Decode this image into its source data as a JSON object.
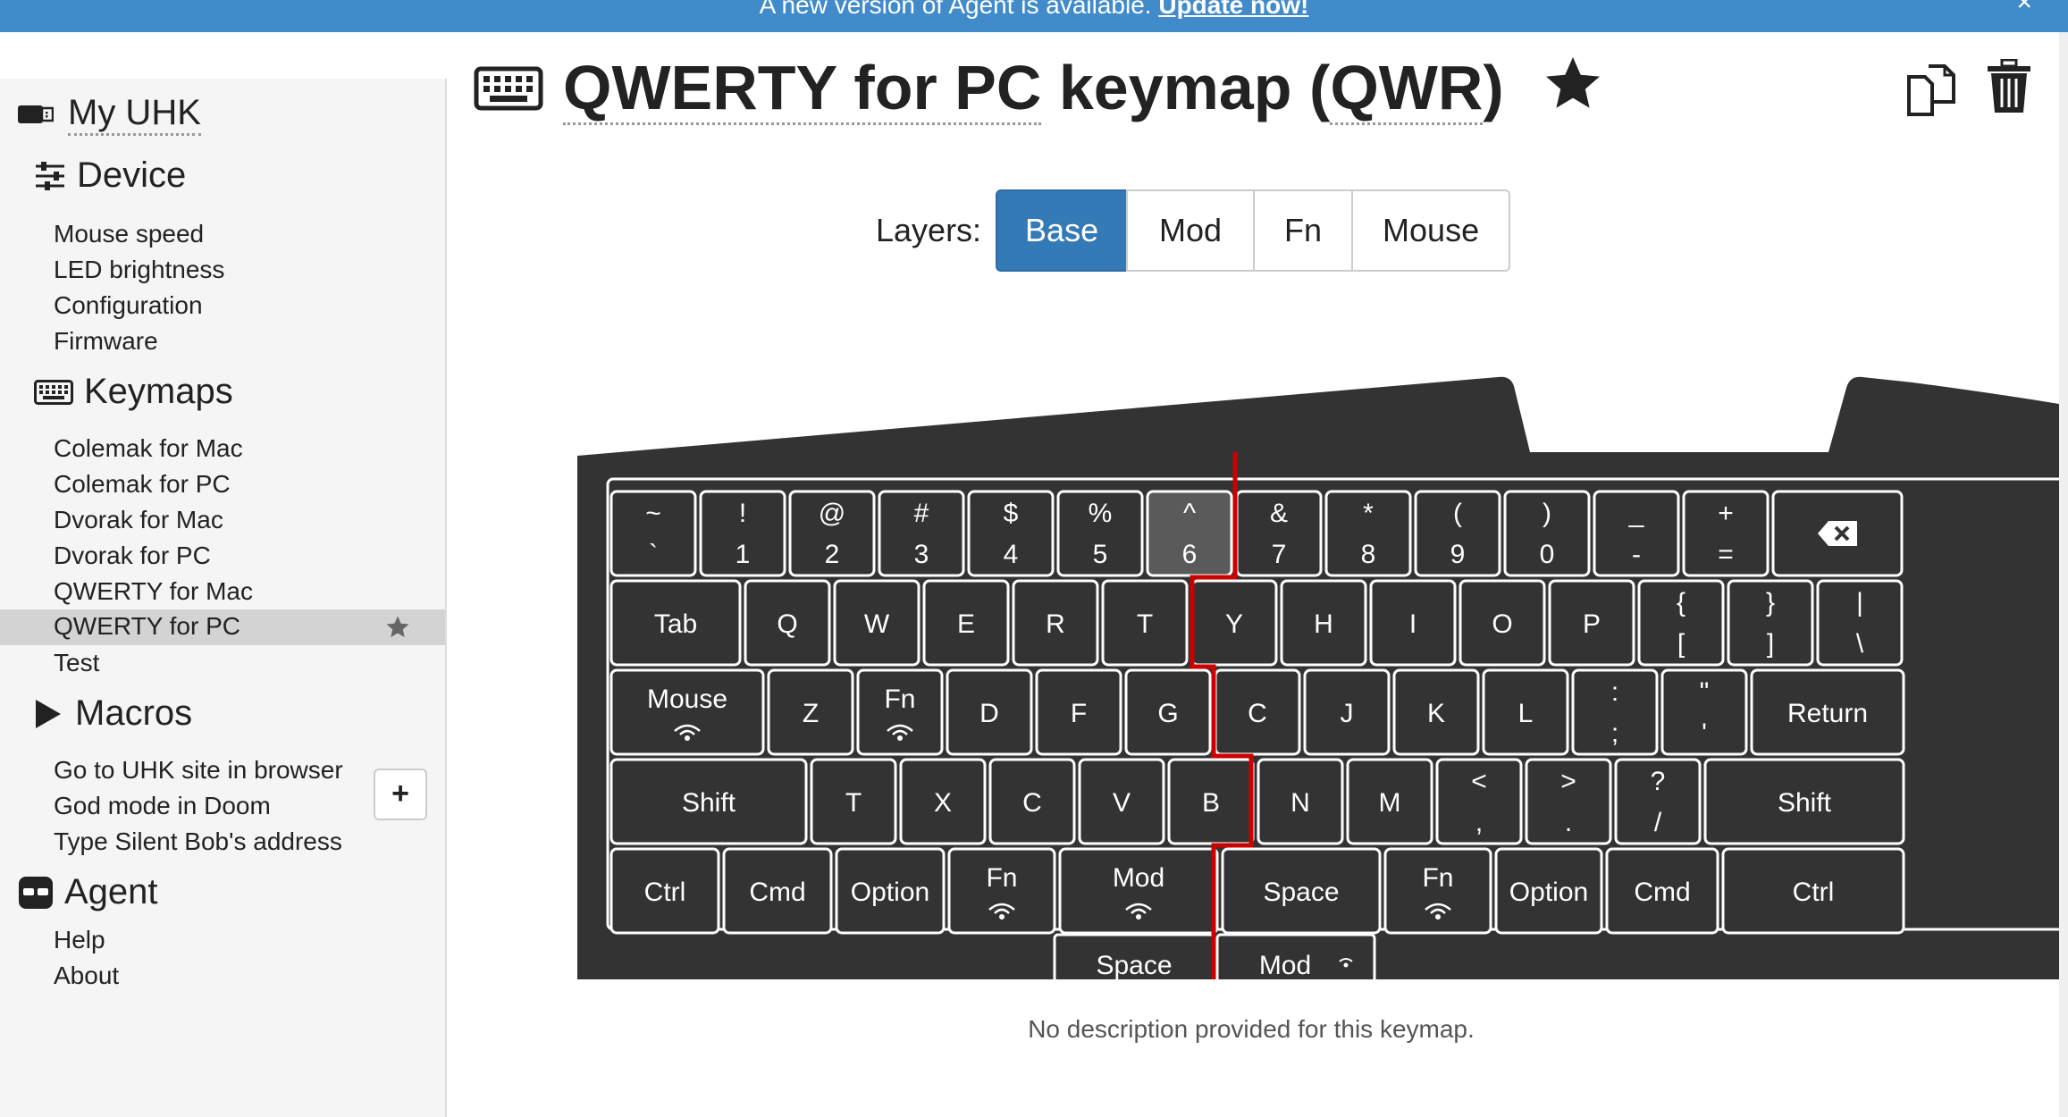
{
  "banner": {
    "text": "A new version of Agent is available.",
    "link": "Update now!",
    "close": "×"
  },
  "sidebar": {
    "my_uhk": "My UHK",
    "device": {
      "title": "Device",
      "items": [
        "Mouse speed",
        "LED brightness",
        "Configuration",
        "Firmware"
      ]
    },
    "keymaps": {
      "title": "Keymaps",
      "items": [
        "Colemak for Mac",
        "Colemak for PC",
        "Dvorak for Mac",
        "Dvorak for PC",
        "QWERTY for Mac",
        "QWERTY for PC",
        "Test"
      ],
      "active": "QWERTY for PC"
    },
    "macros": {
      "title": "Macros",
      "add": "+",
      "items": [
        "Go to UHK site in browser",
        "God mode in Doom",
        "Type Silent Bob's address"
      ]
    },
    "agent": {
      "title": "Agent",
      "items": [
        "Help",
        "About"
      ]
    }
  },
  "header": {
    "name": "QWERTY for PC",
    "suffix": "keymap",
    "abbr_open": "(",
    "abbr": "QWR",
    "abbr_close": ")"
  },
  "layers": {
    "label": "Layers:",
    "options": [
      "Base",
      "Mod",
      "Fn",
      "Mouse"
    ],
    "selected": "Base"
  },
  "keyboard": {
    "rows": [
      [
        {
          "t": "~",
          "b": "`"
        },
        {
          "t": "!",
          "b": "1"
        },
        {
          "t": "@",
          "b": "2"
        },
        {
          "t": "#",
          "b": "3"
        },
        {
          "t": "$",
          "b": "4"
        },
        {
          "t": "%",
          "b": "5"
        },
        {
          "t": "^",
          "b": "6",
          "hl": true
        },
        {
          "t": "&",
          "b": "7"
        },
        {
          "t": "*",
          "b": "8"
        },
        {
          "t": "(",
          "b": "9"
        },
        {
          "t": ")",
          "b": "0"
        },
        {
          "t": "_",
          "b": "-"
        },
        {
          "t": "+",
          "b": "="
        },
        {
          "icon": "backspace-icon"
        }
      ],
      [
        {
          "l": "Tab"
        },
        {
          "l": "Q"
        },
        {
          "l": "W"
        },
        {
          "l": "E"
        },
        {
          "l": "R"
        },
        {
          "l": "T"
        },
        {
          "l": "Y"
        },
        {
          "l": "H"
        },
        {
          "l": "I"
        },
        {
          "l": "O"
        },
        {
          "l": "P"
        },
        {
          "t": "{",
          "b": "["
        },
        {
          "t": "}",
          "b": "]"
        },
        {
          "t": "|",
          "b": "\\"
        }
      ],
      [
        {
          "l": "Mouse",
          "wave": true
        },
        {
          "l": "Z"
        },
        {
          "l": "Fn",
          "wave": true
        },
        {
          "l": "D"
        },
        {
          "l": "F"
        },
        {
          "l": "G"
        },
        {
          "l": "C"
        },
        {
          "l": "J"
        },
        {
          "l": "K"
        },
        {
          "l": "L"
        },
        {
          "t": ":",
          "b": ";"
        },
        {
          "t": "\"",
          "b": "'"
        },
        {
          "l": "Return"
        }
      ],
      [
        {
          "l": "Shift"
        },
        {
          "l": "T"
        },
        {
          "l": "X"
        },
        {
          "l": "C"
        },
        {
          "l": "V"
        },
        {
          "l": "B"
        },
        {
          "l": "N"
        },
        {
          "l": "M"
        },
        {
          "t": "<",
          "b": ","
        },
        {
          "t": ">",
          "b": "."
        },
        {
          "t": "?",
          "b": "/"
        },
        {
          "l": "Shift"
        }
      ],
      [
        {
          "l": "Ctrl"
        },
        {
          "l": "Cmd"
        },
        {
          "l": "Option"
        },
        {
          "l": "Fn",
          "wave": true
        },
        {
          "l": "Mod",
          "wave": true
        },
        {
          "l": "Space"
        },
        {
          "l": "Fn",
          "wave": true
        },
        {
          "l": "Option"
        },
        {
          "l": "Cmd"
        },
        {
          "l": "Ctrl"
        }
      ]
    ],
    "thumb": [
      {
        "l": "Space"
      },
      {
        "l": "Mod",
        "wave": true
      }
    ]
  },
  "description": "No description provided for this keymap.",
  "colors": {
    "banner": "#428bca",
    "keyboard": "#333333",
    "key": "#333333",
    "key_highlight": "#5a5a5a",
    "key_border": "#ffffff",
    "split_line": "#cc0000",
    "layer_active": "#337ab7"
  }
}
